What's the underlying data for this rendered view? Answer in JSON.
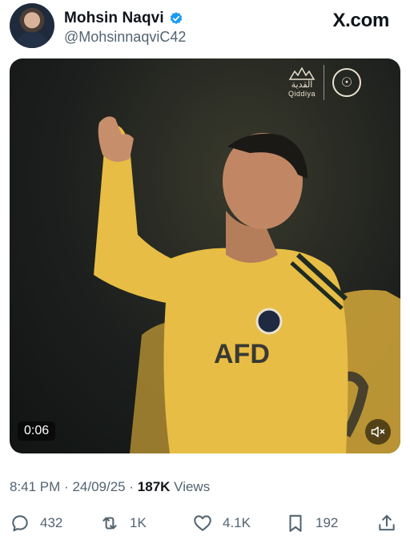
{
  "author": {
    "display_name": "Mohsin Naqvi",
    "handle": "@MohsinnaqviC42",
    "verified_icon": "verified-badge-icon",
    "verified_color": "#1d9bf0"
  },
  "brand": {
    "text": "X.com"
  },
  "media": {
    "duration": "0:06",
    "sponsor_arabic": "القدية",
    "sponsor_latin": "Qiddiya",
    "mute_icon": "speaker-muted-icon",
    "jersey_color": "#e7bd45"
  },
  "meta": {
    "time": "8:41 PM",
    "date": "24/09/25",
    "views_count": "187K",
    "views_label": "Views",
    "separator": "·"
  },
  "actions": {
    "replies": "432",
    "reposts": "1K",
    "likes": "4.1K",
    "bookmarks": "192",
    "icons": [
      "reply-icon",
      "repost-icon",
      "like-icon",
      "bookmark-icon",
      "share-icon"
    ]
  }
}
